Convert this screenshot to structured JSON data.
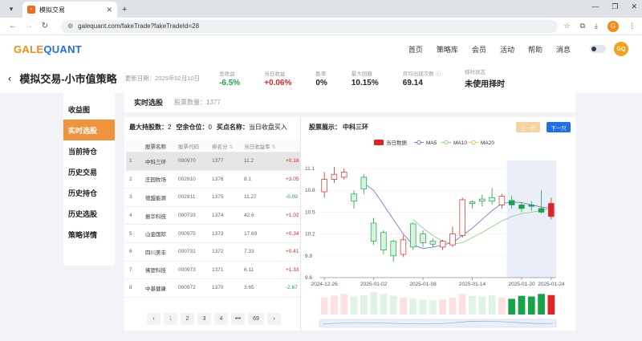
{
  "browser": {
    "tab_title": "模拟交易",
    "url": "galequant.com/fakeTrade?fakeTradeId=28",
    "profile_initial": "G"
  },
  "site": {
    "logo_part1": "GALE",
    "logo_part2": "QUANT",
    "nav": [
      "首页",
      "策略库",
      "会员",
      "活动",
      "帮助",
      "消息"
    ],
    "avatar": "GQ"
  },
  "strategy": {
    "title": "模拟交易-小市值策略",
    "updated": "更新日期：2025年02月10日",
    "metrics": [
      {
        "label": "总收益",
        "value": "-6.5%",
        "color": "green"
      },
      {
        "label": "当日收益",
        "value": "+0.06%",
        "color": "red"
      },
      {
        "label": "胜率",
        "value": "0%",
        "color": ""
      },
      {
        "label": "最大回撤",
        "value": "10.15%",
        "color": ""
      },
      {
        "label": "月均出现次数 ⓘ",
        "value": "69.14",
        "color": ""
      },
      {
        "label": "择时状态",
        "value": "未使用择时",
        "color": ""
      }
    ]
  },
  "leftnav": [
    "收益图",
    "实时选股",
    "当前持仓",
    "历史交易",
    "历史持仓",
    "历史选股",
    "策略详情"
  ],
  "topcard": {
    "title": "实时选股",
    "count": "股票数量：1377"
  },
  "holdings": {
    "max_label": "最大持股数：",
    "max_value": "2",
    "empty_label": "空余仓位：",
    "empty_value": "0",
    "buy_label": "买点名称：",
    "buy_value": "当日收盘买入"
  },
  "table": {
    "headers": [
      "",
      "股票名称",
      "股票代码",
      "排名分",
      "当日收益率",
      ""
    ],
    "rows": [
      {
        "idx": "1",
        "name": "中科三环",
        "code": "000970",
        "score": "1377",
        "ret": "11.2",
        "chg": "+0.18",
        "chg_color": "red"
      },
      {
        "idx": "2",
        "name": "庄园牧场",
        "code": "002910",
        "score": "1376",
        "ret": "8.1",
        "chg": "+3.05",
        "chg_color": "red"
      },
      {
        "idx": "3",
        "name": "德盟能源",
        "code": "002911",
        "score": "1375",
        "ret": "11.27",
        "chg": "-0.09",
        "chg_color": "green"
      },
      {
        "idx": "4",
        "name": "振华科技",
        "code": "000733",
        "score": "1374",
        "ret": "42.6",
        "chg": "+1.02",
        "chg_color": "red"
      },
      {
        "idx": "5",
        "name": "山金国际",
        "code": "000975",
        "score": "1373",
        "ret": "17.69",
        "chg": "+0.34",
        "chg_color": "red"
      },
      {
        "idx": "6",
        "name": "四川美丰",
        "code": "000731",
        "score": "1372",
        "ret": "7.33",
        "chg": "+0.41",
        "chg_color": "red"
      },
      {
        "idx": "7",
        "name": "佛塑科技",
        "code": "000973",
        "score": "1371",
        "ret": "6.11",
        "chg": "+1.33",
        "chg_color": "red"
      },
      {
        "idx": "8",
        "name": "中基健康",
        "code": "000972",
        "score": "1370",
        "ret": "3.65",
        "chg": "-2.67",
        "chg_color": "green"
      }
    ]
  },
  "pagination": {
    "pages": [
      "1",
      "2",
      "3",
      "4",
      "•••",
      "69"
    ],
    "current": "1"
  },
  "kline": {
    "label": "股票展示：",
    "stock": "中科三环",
    "prev": "上一只",
    "next": "下一只",
    "legend": [
      {
        "name": "当日数据",
        "color": "#e02424"
      },
      {
        "name": "MA5",
        "color": "#6f7fd8"
      },
      {
        "name": "MA10",
        "color": "#8fd37c"
      },
      {
        "name": "MA20",
        "color": "#f3c34b"
      }
    ],
    "colors": {
      "up": "#e02424",
      "down": "#17a34a"
    }
  },
  "chart_data": {
    "type": "candlestick",
    "title": "",
    "ylim": [
      9.6,
      11.1
    ],
    "yticks": [
      9.6,
      9.9,
      10.2,
      10.5,
      10.8,
      11.1
    ],
    "xticks": [
      "2024-12-26",
      "2025-01-02",
      "2025-01-08",
      "2025-01-14",
      "2025-01-20",
      "2025-01-24"
    ],
    "candles": [
      {
        "open": 10.78,
        "close": 10.95,
        "high": 11.05,
        "low": 10.7
      },
      {
        "open": 10.95,
        "close": 11.02,
        "high": 11.12,
        "low": 10.9
      },
      {
        "open": 10.98,
        "close": 11.05,
        "high": 11.1,
        "low": 10.95
      },
      {
        "open": 10.75,
        "close": 10.65,
        "high": 10.8,
        "low": 10.55
      },
      {
        "open": 10.98,
        "close": 10.82,
        "high": 11.02,
        "low": 10.75
      },
      {
        "open": 10.35,
        "close": 10.1,
        "high": 10.42,
        "low": 10.05
      },
      {
        "open": 10.22,
        "close": 9.98,
        "high": 10.25,
        "low": 9.92
      },
      {
        "open": 10.1,
        "close": 9.9,
        "high": 10.12,
        "low": 9.82
      },
      {
        "open": 9.92,
        "close": 10.12,
        "high": 10.18,
        "low": 9.88
      },
      {
        "open": 10.34,
        "close": 10.02,
        "high": 10.36,
        "low": 9.98
      },
      {
        "open": 10.2,
        "close": 10.08,
        "high": 10.25,
        "low": 10.02
      },
      {
        "open": 10.1,
        "close": 10.06,
        "high": 10.14,
        "low": 10.02
      },
      {
        "open": 10.02,
        "close": 10.1,
        "high": 10.12,
        "low": 9.98
      },
      {
        "open": 10.05,
        "close": 10.2,
        "high": 10.3,
        "low": 10.02
      },
      {
        "open": 10.18,
        "close": 10.67,
        "high": 10.7,
        "low": 10.15
      },
      {
        "open": 10.64,
        "close": 10.62,
        "high": 10.66,
        "low": 10.55
      },
      {
        "open": 10.68,
        "close": 10.65,
        "high": 10.74,
        "low": 10.58
      },
      {
        "open": 10.7,
        "close": 10.65,
        "high": 10.83,
        "low": 10.6
      },
      {
        "open": 10.6,
        "close": 10.72,
        "high": 10.75,
        "low": 10.55
      },
      {
        "open": 10.66,
        "close": 10.6,
        "high": 10.72,
        "low": 10.55
      },
      {
        "open": 10.6,
        "close": 10.55,
        "high": 10.64,
        "low": 10.5
      },
      {
        "open": 10.6,
        "close": 10.58,
        "high": 10.65,
        "low": 10.52
      },
      {
        "open": 10.55,
        "close": 10.5,
        "high": 10.8,
        "low": 10.48
      },
      {
        "open": 10.44,
        "close": 10.62,
        "high": 10.7,
        "low": 10.4
      }
    ],
    "ma5": [
      null,
      null,
      null,
      null,
      10.9,
      10.8,
      10.6,
      10.4,
      10.2,
      10.05,
      10.0,
      10.02,
      10.05,
      10.08,
      10.18,
      10.28,
      10.4,
      10.52,
      10.62,
      10.64,
      10.63,
      10.6,
      10.57,
      10.55
    ],
    "ma10": [
      null,
      null,
      null,
      null,
      null,
      null,
      null,
      null,
      null,
      10.4,
      10.28,
      10.18,
      10.1,
      10.06,
      10.08,
      10.15,
      10.22,
      10.3,
      10.38,
      10.44,
      10.48,
      10.5,
      10.52,
      10.55
    ],
    "volume": [
      0.45,
      0.5,
      0.55,
      0.48,
      0.52,
      0.6,
      0.55,
      0.5,
      0.45,
      0.42,
      0.4,
      0.38,
      0.4,
      0.45,
      0.55,
      0.5,
      0.48,
      0.52,
      0.45,
      0.42,
      0.5,
      0.48,
      0.55,
      0.52
    ],
    "highlight_range": [
      19,
      23
    ]
  }
}
